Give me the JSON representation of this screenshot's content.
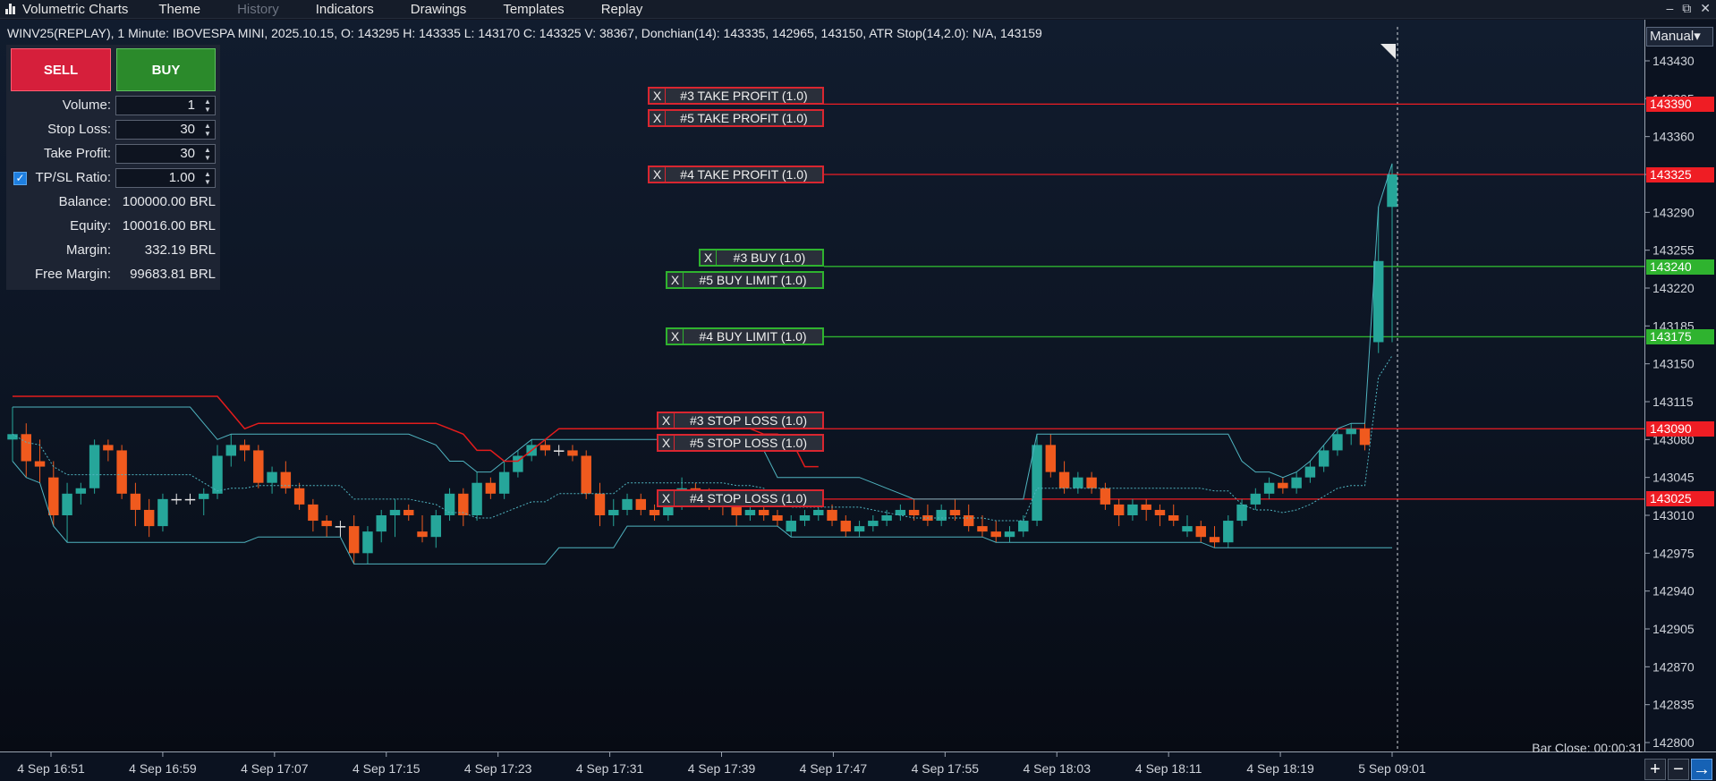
{
  "menubar": {
    "app_title": "Volumetric Charts",
    "items": [
      "Theme",
      "History",
      "Indicators",
      "Drawings",
      "Templates",
      "Replay"
    ],
    "disabled_index": 1,
    "window_controls": [
      "–",
      "⧉",
      "✕"
    ]
  },
  "info_line": "WINV25(REPLAY), 1 Minute: IBOVESPA MINI, 2025.10.15, O: 143295 H: 143335 L: 143170 C: 143325 V: 38367, Donchian(14):  143335, 142965, 143150, ATR Stop(14,2.0):  N/A, 143159",
  "trade_panel": {
    "sell_label": "SELL",
    "buy_label": "BUY",
    "volume_label": "Volume:",
    "volume_value": "1",
    "stop_loss_label": "Stop Loss:",
    "stop_loss_value": "30",
    "take_profit_label": "Take Profit:",
    "take_profit_value": "30",
    "tpsl_label": "TP/SL Ratio:",
    "tpsl_value": "1.00",
    "tpsl_checked": true,
    "balance_label": "Balance:",
    "balance_value": "100000.00 BRL",
    "equity_label": "Equity:",
    "equity_value": "100016.00 BRL",
    "margin_label": "Margin:",
    "margin_value": "332.19 BRL",
    "free_margin_label": "Free Margin:",
    "free_margin_value": "99683.81 BRL"
  },
  "orders": [
    {
      "label": "#3 TAKE PROFIT (1.0)",
      "kind": "red"
    },
    {
      "label": "#5 TAKE PROFIT (1.0)",
      "kind": "red"
    },
    {
      "label": "#4 TAKE PROFIT (1.0)",
      "kind": "red"
    },
    {
      "label": "#3 BUY (1.0)",
      "kind": "green"
    },
    {
      "label": "#5 BUY LIMIT (1.0)",
      "kind": "green"
    },
    {
      "label": "#4 BUY LIMIT (1.0)",
      "kind": "green"
    },
    {
      "label": "#3 STOP LOSS (1.0)",
      "kind": "red"
    },
    {
      "label": "#5 STOP LOSS (1.0)",
      "kind": "red"
    },
    {
      "label": "#4 STOP LOSS (1.0)",
      "kind": "red"
    }
  ],
  "order_close_glyph": "X",
  "price_axis": {
    "manual_label": "Manual▾",
    "ticks": [
      "143430",
      "143395",
      "143360",
      "143325",
      "143290",
      "143255",
      "143220",
      "143185",
      "143150",
      "143115",
      "143080",
      "143045",
      "143010",
      "142975",
      "142940",
      "142905",
      "142870",
      "142835",
      "142800"
    ],
    "tags": [
      {
        "value": "143390",
        "kind": "red"
      },
      {
        "value": "143325",
        "kind": "red"
      },
      {
        "value": "143240",
        "kind": "green"
      },
      {
        "value": "143175",
        "kind": "green"
      },
      {
        "value": "143090",
        "kind": "red"
      },
      {
        "value": "143025",
        "kind": "red"
      }
    ]
  },
  "time_axis": [
    "4 Sep 16:51",
    "4 Sep 16:59",
    "4 Sep 17:07",
    "4 Sep 17:15",
    "4 Sep 17:23",
    "4 Sep 17:31",
    "4 Sep 17:39",
    "4 Sep 17:47",
    "4 Sep 17:55",
    "4 Sep 18:03",
    "4 Sep 18:11",
    "4 Sep 18:19",
    "5 Sep 09:01"
  ],
  "bar_close": "Bar Close: 00:00:31",
  "zoom_buttons": [
    "+",
    "−",
    "→"
  ],
  "colors": {
    "up": "#26a69a",
    "down": "#f05a1e",
    "sell": "#d61f3b",
    "buy": "#2b8a2b",
    "tp_sl": "#ef1d24",
    "entry": "#2fb32f",
    "donchian": "#4fb3bf",
    "atr": "#e31c1c"
  },
  "chart_data": {
    "type": "candlestick",
    "symbol": "WINV25",
    "ylim": [
      142800,
      143430
    ],
    "candles": [
      [
        143080,
        143110,
        143060,
        143085
      ],
      [
        143085,
        143095,
        143045,
        143060
      ],
      [
        143060,
        143080,
        143040,
        143055
      ],
      [
        143045,
        143060,
        143000,
        143010
      ],
      [
        143010,
        143040,
        142985,
        143030
      ],
      [
        143030,
        143040,
        143020,
        143035
      ],
      [
        143035,
        143080,
        143030,
        143075
      ],
      [
        143075,
        143080,
        143060,
        143070
      ],
      [
        143070,
        143075,
        143025,
        143030
      ],
      [
        143030,
        143040,
        143000,
        143015
      ],
      [
        143015,
        143025,
        142990,
        143000
      ],
      [
        143000,
        143030,
        142995,
        143025
      ],
      [
        143025,
        143030,
        143020,
        143025
      ],
      [
        143025,
        143030,
        143020,
        143025
      ],
      [
        143025,
        143035,
        143010,
        143030
      ],
      [
        143030,
        143075,
        143025,
        143065
      ],
      [
        143065,
        143085,
        143055,
        143075
      ],
      [
        143075,
        143080,
        143060,
        143070
      ],
      [
        143070,
        143075,
        143035,
        143040
      ],
      [
        143040,
        143055,
        143030,
        143050
      ],
      [
        143050,
        143060,
        143030,
        143035
      ],
      [
        143035,
        143040,
        143015,
        143020
      ],
      [
        143020,
        143025,
        142995,
        143005
      ],
      [
        143005,
        143010,
        142990,
        143000
      ],
      [
        143000,
        143005,
        142990,
        143000
      ],
      [
        143000,
        143010,
        142965,
        142975
      ],
      [
        142975,
        143000,
        142965,
        142995
      ],
      [
        142995,
        143015,
        142985,
        143010
      ],
      [
        143010,
        143025,
        142990,
        143015
      ],
      [
        143015,
        143020,
        143005,
        143010
      ],
      [
        142995,
        143010,
        142985,
        142990
      ],
      [
        142990,
        143015,
        142980,
        143010
      ],
      [
        143010,
        143035,
        143005,
        143030
      ],
      [
        143030,
        143035,
        143000,
        143010
      ],
      [
        143010,
        143050,
        143005,
        143040
      ],
      [
        143040,
        143045,
        143025,
        143030
      ],
      [
        143030,
        143060,
        143025,
        143050
      ],
      [
        143050,
        143070,
        143045,
        143065
      ],
      [
        143065,
        143080,
        143060,
        143075
      ],
      [
        143075,
        143080,
        143065,
        143070
      ],
      [
        143070,
        143075,
        143065,
        143070
      ],
      [
        143070,
        143075,
        143060,
        143065
      ],
      [
        143065,
        143070,
        143025,
        143030
      ],
      [
        143030,
        143040,
        143000,
        143010
      ],
      [
        143010,
        143025,
        143000,
        143015
      ],
      [
        143015,
        143030,
        143010,
        143025
      ],
      [
        143025,
        143030,
        143010,
        143015
      ],
      [
        143015,
        143020,
        143005,
        143010
      ],
      [
        143010,
        143025,
        143005,
        143020
      ],
      [
        143020,
        143045,
        143015,
        143035
      ],
      [
        143035,
        143040,
        143025,
        143030
      ],
      [
        143030,
        143035,
        143015,
        143025
      ],
      [
        143025,
        143030,
        143010,
        143020
      ],
      [
        143020,
        143025,
        143000,
        143010
      ],
      [
        143010,
        143025,
        143005,
        143015
      ],
      [
        143015,
        143020,
        143005,
        143010
      ],
      [
        143010,
        143015,
        143000,
        143005
      ],
      [
        142995,
        143010,
        142990,
        143005
      ],
      [
        143005,
        143015,
        143000,
        143010
      ],
      [
        143010,
        143020,
        143005,
        143015
      ],
      [
        143015,
        143020,
        143000,
        143005
      ],
      [
        143005,
        143010,
        142990,
        142995
      ],
      [
        142995,
        143005,
        142990,
        143000
      ],
      [
        143000,
        143010,
        142995,
        143005
      ],
      [
        143005,
        143015,
        143000,
        143010
      ],
      [
        143010,
        143020,
        143005,
        143015
      ],
      [
        143015,
        143025,
        143005,
        143010
      ],
      [
        143010,
        143020,
        143000,
        143005
      ],
      [
        143005,
        143020,
        143000,
        143015
      ],
      [
        143015,
        143025,
        143005,
        143010
      ],
      [
        143010,
        143020,
        142995,
        143000
      ],
      [
        143000,
        143010,
        142990,
        142995
      ],
      [
        142995,
        143005,
        142985,
        142990
      ],
      [
        142990,
        143000,
        142985,
        142995
      ],
      [
        142995,
        143010,
        142990,
        143005
      ],
      [
        143005,
        143085,
        143000,
        143075
      ],
      [
        143075,
        143085,
        143045,
        143050
      ],
      [
        143050,
        143060,
        143030,
        143035
      ],
      [
        143035,
        143050,
        143030,
        143045
      ],
      [
        143045,
        143050,
        143030,
        143035
      ],
      [
        143035,
        143040,
        143015,
        143020
      ],
      [
        143020,
        143025,
        143000,
        143010
      ],
      [
        143010,
        143025,
        143005,
        143020
      ],
      [
        143020,
        143025,
        143005,
        143015
      ],
      [
        143015,
        143020,
        143000,
        143010
      ],
      [
        143010,
        143020,
        143000,
        143005
      ],
      [
        142995,
        143010,
        142990,
        143000
      ],
      [
        143000,
        143005,
        142985,
        142990
      ],
      [
        142990,
        143000,
        142980,
        142985
      ],
      [
        142985,
        143010,
        142980,
        143005
      ],
      [
        143005,
        143025,
        143000,
        143020
      ],
      [
        143020,
        143035,
        143015,
        143030
      ],
      [
        143030,
        143045,
        143025,
        143040
      ],
      [
        143040,
        143045,
        143030,
        143035
      ],
      [
        143035,
        143050,
        143030,
        143045
      ],
      [
        143045,
        143060,
        143040,
        143055
      ],
      [
        143055,
        143075,
        143050,
        143070
      ],
      [
        143070,
        143090,
        143065,
        143085
      ],
      [
        143085,
        143095,
        143075,
        143090
      ],
      [
        143090,
        143095,
        143070,
        143075
      ],
      [
        143170,
        143295,
        143160,
        143245
      ],
      [
        143295,
        143335,
        143170,
        143325
      ]
    ]
  }
}
